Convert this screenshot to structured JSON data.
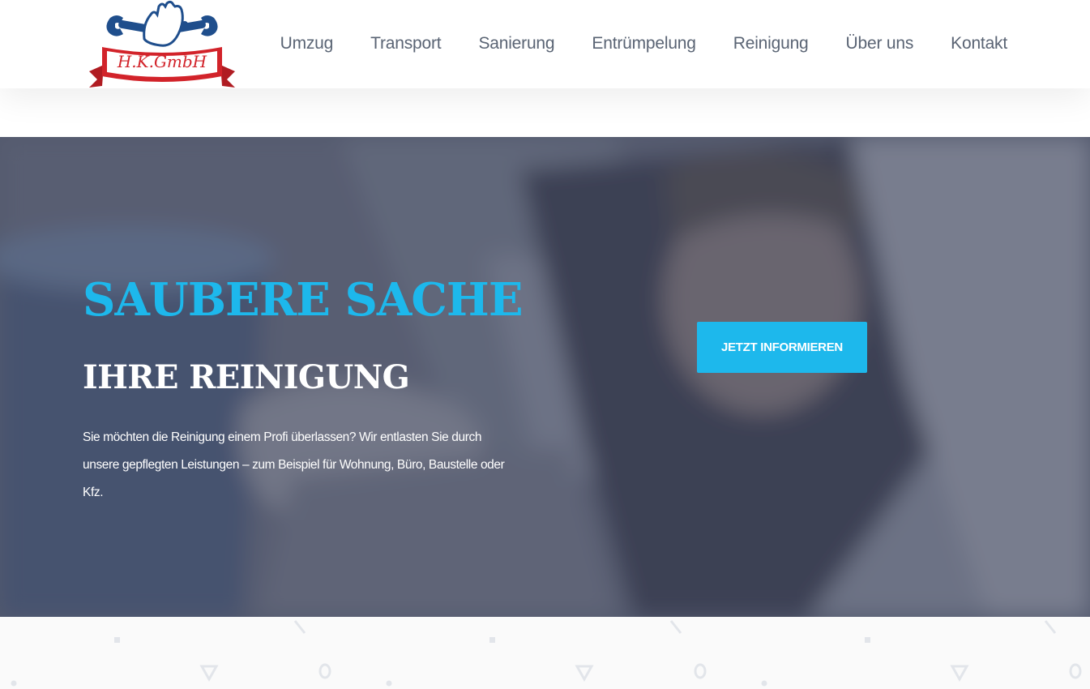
{
  "brand": {
    "logo_text": "H.K.GmbH",
    "colors": {
      "primary_blue": "#1db8ec",
      "logo_navy": "#1f4e8c",
      "logo_red": "#d2232a"
    }
  },
  "nav": {
    "items": [
      {
        "label": "Umzug"
      },
      {
        "label": "Transport"
      },
      {
        "label": "Sanierung"
      },
      {
        "label": "Entrümpelung"
      },
      {
        "label": "Reinigung"
      },
      {
        "label": "Über uns"
      },
      {
        "label": "Kontakt"
      }
    ]
  },
  "hero": {
    "title": "SAUBERE SACHE",
    "subtitle": "IHRE REINIGUNG",
    "text": "Sie möchten die Reinigung einem Profi überlassen? Wir entlasten Sie durch unsere gepflegten Leistungen – zum Beispiel für Wohnung, Büro, Baustelle oder Kfz.",
    "button_label": "JETZT INFORMIEREN",
    "background_image": "person-cleaning-photo"
  },
  "icons": {
    "logo": "wrench-tools-logo-icon"
  }
}
